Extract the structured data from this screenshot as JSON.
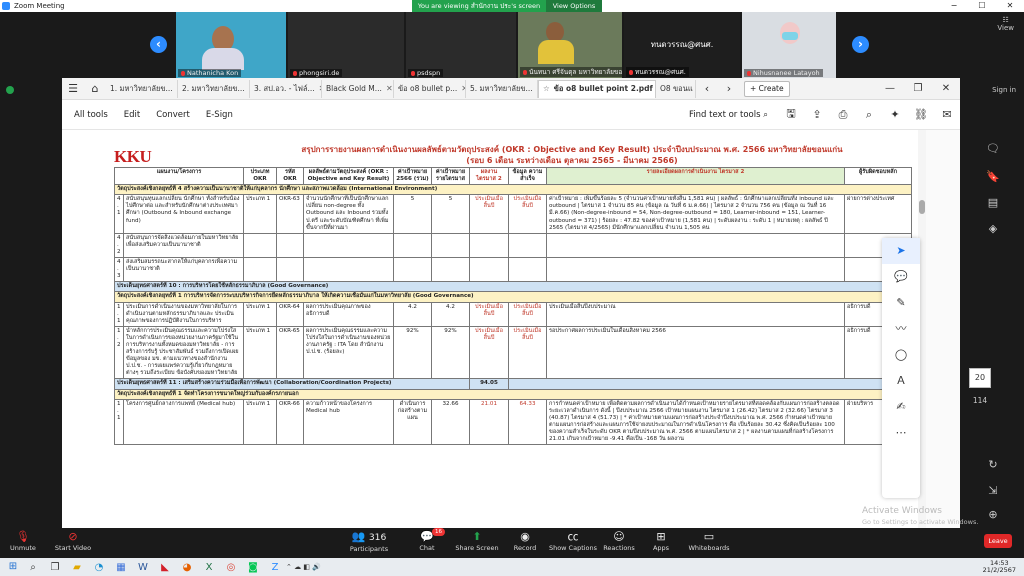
{
  "zoom": {
    "window_title": "Zoom Meeting",
    "viewing_banner": "You are viewing สำนักงาน ประ's screen",
    "view_options": "View Options",
    "gallery_view": "View",
    "sign_in": "Sign in",
    "participants": [
      {
        "name": "Nathanicha Kon"
      },
      {
        "name": "phongsiri.de"
      },
      {
        "name": "psdspn"
      },
      {
        "name": "นันทนา ศรีจันตุล มหาวิทยาลัยขอ..."
      },
      {
        "name": "ทนดวรรณ@ศนศ.",
        "center_text": "ทนดวรรณ@ศนศ."
      },
      {
        "name": "Nihusnanee Latayoh"
      }
    ],
    "toolbar": {
      "unmute": "Unmute",
      "start_video": "Start Video",
      "participants_label": "Participants",
      "participants_count": "316",
      "chat": "Chat",
      "chat_badge": "16",
      "share_screen": "Share Screen",
      "record": "Record",
      "show_captions": "Show Captions",
      "reactions": "Reactions",
      "apps": "Apps",
      "whiteboards": "Whiteboards",
      "leave": "Leave"
    },
    "watermark_title": "Activate Windows",
    "watermark_sub": "Go to Settings to activate Windows."
  },
  "acrobat": {
    "tabs": [
      {
        "label": "1. มหาวิทยาลัยข..."
      },
      {
        "label": "2. มหาวิทยาลัยข..."
      },
      {
        "label": "3. สป.อว. - ไฟล์..."
      },
      {
        "label": "Black Gold M..."
      },
      {
        "label": "ข้อ o8 bullet p..."
      },
      {
        "label": "5. มหาวิทยาลัยข..."
      },
      {
        "label": "ข้อ o8 bullet point 2.pdf",
        "active": true
      },
      {
        "label": "O8 ขอนแ"
      }
    ],
    "create_label": "Create",
    "menu": {
      "all_tools": "All tools",
      "edit": "Edit",
      "convert": "Convert",
      "esign": "E-Sign",
      "find": "Find text or tools"
    },
    "page_number": "20",
    "page_total": "114"
  },
  "document": {
    "logo": "KKU",
    "logo_sub": "KHON KAEN UNIVERSITY",
    "title": "สรุปการรายงานผลการดำเนินงานผลลัพธ์ตามวัตถุประสงค์ (OKR : Objective and Key Result) ประจำปีงบประมาณ พ.ศ. 2566 มหาวิทยาลัยขอนแก่น",
    "subtitle": "(รอบ 6 เดือน ระหว่างเดือน ตุลาคม 2565 - มีนาคม 2566)",
    "headers": {
      "plan": "แผนงาน/โครงการ",
      "type": "ประเภท OKR",
      "code": "รหัส OKR",
      "result": "ผลลัพธ์ตามวัตถุประสงค์ (OKR : Objective and Key Result)",
      "target": "ค่าเป้าหมาย 2566 (รวม)",
      "annual": "ค่าเป้าหมาย รายไตรมาส",
      "q2": "ผลงาน ไตรมาส 2",
      "data": "ข้อมูล ความสำเร็จ",
      "detail": "รายละเอียดผลการดำเนินงาน ไตรมาส 2",
      "owner": "ผู้รับผิดชอบหลัก"
    },
    "sections": [
      {
        "kind": "obj",
        "text": "วัตถุประสงค์เชิงกลยุทธ์ที่ 4 สร้างความเป็นนานาชาติให้แก่บุคลากร นักศึกษา และสภาพแวดล้อม (International Environment)"
      },
      {
        "kind": "row",
        "num": "4.1",
        "plan": "สนับสนุนทุนแลกเปลี่ยน นักศึกษา ทั้งสำหรับน้องไปศึกษาต่อ และสำหรับนักศึกษาต่างประเทศมาศึกษา (Outbound & Inbound exchange fund)",
        "type": "ประเภท 1",
        "code": "OKR-63",
        "result": "จำนวนนักศึกษาที่เป็นนักศึกษาแลกเปลี่ยน non-degree ทั้ง Outbound และ Inbound รวมทั้ง ป.ตรี และระดับบัณฑิตศึกษา ที่เพิ่มขึ้นจากปีที่ผ่านมา",
        "target": "5",
        "annual": "5",
        "q2": "ประเมินเมื่อสิ้นปี",
        "data": "ประเมินเมื่อสิ้นปี",
        "detail": "ค่าเป้าหมาย : เพิ่มขึ้นร้อยละ 5 (จำนวนค่าเป้าหมายทั้งสิ้น 1,581 คน) | ผลลัพธ์ : นักศึกษาแลกเปลี่ยนทั้ง inbound และ outbound | ไตรมาส 1 จำนวน 85 คน (ข้อมูล ณ วันที่ 6 ม.ค.66) | ไตรมาส 2 จำนวน 756 คน (ข้อมูล ณ วันที่ 16 มี.ค.66) (Non-degree-inbound = 54, Non-degree-outbound = 180, Learner-inbound = 151, Learner-outbound = 371) | ร้อยละ : 47.82 ของค่าเป้าหมาย (1,581 คน) | ระดับผลงาน : ระดับ 1 | หมายเหตุ : ผลลัพธ์ ปี 2565 (ไตรมาส 4/2565) มีนักศึกษาแลกเปลี่ยน จำนวน 1,505 คน",
        "owner": "ผ่ายการต่างประเทศ"
      },
      {
        "kind": "sub",
        "num": "4.2",
        "plan": "สนับสนุนการจัดสิ่งแวดล้อมภายในมหาวิทยาลัยเพื่อส่งเสริมความเป็นนานาชาติ"
      },
      {
        "kind": "sub",
        "num": "4.3",
        "plan": "ส่งเสริมสมรรถนะสากลให้แก่บุคลากรเพื่อความเป็นนานาชาติ"
      },
      {
        "kind": "strat",
        "text": "ประเด็นยุทธศาสตร์ที่ 10 : การบริหารโดยใช้หลักธรรมาภิบาล (Good Governance)"
      },
      {
        "kind": "obj",
        "text": "วัตถุประสงค์เชิงกลยุทธ์ที่ 1 การบริหารจัดการระบบบริหารกิจการยึดหลักธรรมาภิบาล ให้เกิดความเชื่อมั่นแก่ในมหาวิทยาลัย (Good Governance)"
      },
      {
        "kind": "row",
        "num": "1.1",
        "plan": "ประเมินการดำเนินงานของมหาวิทยาลัยในการดำเนินงานตามหลักธรรมาภิบาลและ ประเมินคุณภาพของการปฏิบัติงานในการบริหาร",
        "type": "ประเภท 1",
        "code": "OKR-64",
        "result": "ผลการประเมินคุณภาพของอธิการบดี",
        "target": "4.2",
        "annual": "4.2",
        "q2": "ประเมินเมื่อสิ้นปี",
        "data": "ประเมินเมื่อสิ้นปี",
        "detail": "ประเมินเมื่อสิ้นปีงบประมาณ",
        "owner": "อธิการบดี"
      },
      {
        "kind": "row",
        "num": "1.2",
        "plan": "นำหลักการประเมินคุณธรรมและความโปร่งใสในการดำเนินการของหน่วยงานภาครัฐมาใช้ในการบริหารงานทั้งหมดของมหาวิทยาลัย - การสร้างการรับรู้ ประชาสัมพันธ์ รวมถึงการเปิดเผยข้อมูลของ มข. ตามแนวทางของสำนักงาน ป.ป.ช. - การเผยแพร่ความรู้เกี่ยวกับกฎหมายต่างๆ รวมถึงระเบียบ ข้อบังคับของมหาวิทยาลัย",
        "type": "ประเภท 1",
        "code": "OKR-65",
        "result": "ผลการประเมินคุณธรรมและความโปร่งใสในการดำเนินงานของหน่วยงานภาครัฐ : ITA โดย สำนักงาน ป.ป.ช. (ร้อยละ)",
        "target": "92%",
        "annual": "92%",
        "q2": "ประเมินเมื่อสิ้นปี",
        "data": "ประเมินเมื่อสิ้นปี",
        "detail": "รอประกาศผลการประเมินในเดือนสิงหาคม 2566",
        "owner": "อธิการบดี"
      },
      {
        "kind": "strat",
        "text": "ประเด็นยุทธศาสตร์ที่ 11 : เสริมสร้างความร่วมมือเพื่อการพัฒนา (Collaboration/Coordination Projects)",
        "score": "94.05"
      },
      {
        "kind": "obj",
        "text": "วัตถุประสงค์เชิงกลยุทธ์ที่ 1 จัดทำโครงการขนาดใหญ่ร่วมกับองค์กรภายนอก"
      },
      {
        "kind": "row",
        "num": "1.1",
        "plan": "โครงการศูนย์กลางการแพทย์ (Medical hub)",
        "type": "ประเภท 1",
        "code": "OKR-66",
        "result": "ความก้าวหน้าของโครงการ Medical hub",
        "target": "ดำเนินการก่อสร้างตามแผน",
        "annual": "32.66",
        "q2": "21.01",
        "data": "64.33",
        "detail": "การก่ำหนดค่าเป้าหมาย เพื่อติดตามผลการดำเนินงานได้กำหนดเป้าหมายรายไตรมาสที่สอดคล้องกับแผนการก่อสร้างตลอดระยะเวลาดำเนินการ ดังนี้ | ปีงบประมาณ 2566 เป้าหมายแผนงาน ไตรมาส 1 (26.42) ไตรมาส 2 (32.66) ไตรมาส 3 (40.87) ไตรมาส 4 (51.73) | * ค่าเป้าหมายตามแผนการก่อสร้างประจำปีงบประมาณ พ.ศ. 2566 กำหนดค่าเป้าหมายตามแผนการก่อสร้างและแผนการใช้จ่ายงบประมาณในการดำเนินโครงการ คือ เป็นร้อยละ 30.42 ซึ่งคิดเป็นร้อยละ 100 ของความสำเร็จในระดับ OKR ตามปีงบประมาณ พ.ศ. 2566 ตามแผนไตรมาส 2 | * ผลงานตามแผนที่ก่อสร้างโครงการ 21.01 เกินจากเป้าหมาย -9.41 คือเป็น -168 วัน ผลงาน",
        "owner": "ฝ่ายบริหาร"
      }
    ]
  }
}
